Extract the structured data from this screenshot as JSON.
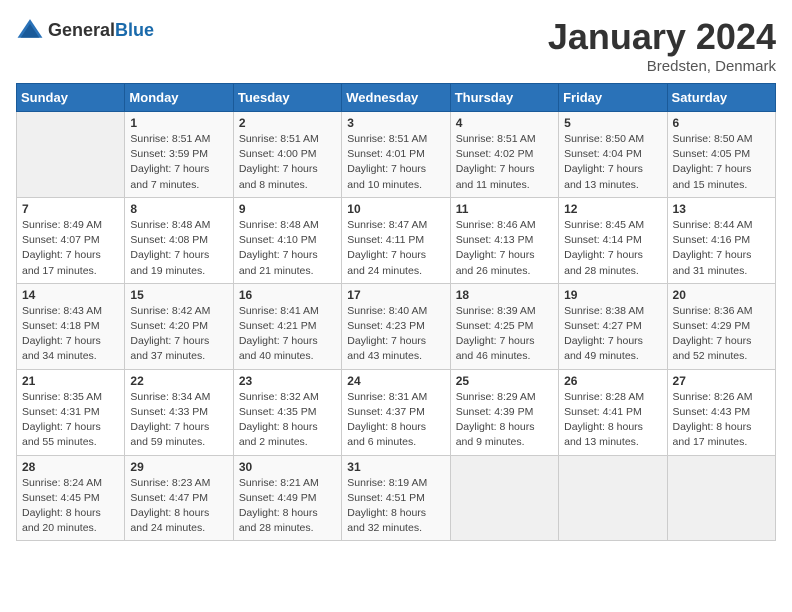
{
  "header": {
    "logo_general": "General",
    "logo_blue": "Blue",
    "month_title": "January 2024",
    "location": "Bredsten, Denmark"
  },
  "days_of_week": [
    "Sunday",
    "Monday",
    "Tuesday",
    "Wednesday",
    "Thursday",
    "Friday",
    "Saturday"
  ],
  "weeks": [
    [
      {
        "day": "",
        "sunrise": "",
        "sunset": "",
        "daylight": ""
      },
      {
        "day": "1",
        "sunrise": "Sunrise: 8:51 AM",
        "sunset": "Sunset: 3:59 PM",
        "daylight": "Daylight: 7 hours and 7 minutes."
      },
      {
        "day": "2",
        "sunrise": "Sunrise: 8:51 AM",
        "sunset": "Sunset: 4:00 PM",
        "daylight": "Daylight: 7 hours and 8 minutes."
      },
      {
        "day": "3",
        "sunrise": "Sunrise: 8:51 AM",
        "sunset": "Sunset: 4:01 PM",
        "daylight": "Daylight: 7 hours and 10 minutes."
      },
      {
        "day": "4",
        "sunrise": "Sunrise: 8:51 AM",
        "sunset": "Sunset: 4:02 PM",
        "daylight": "Daylight: 7 hours and 11 minutes."
      },
      {
        "day": "5",
        "sunrise": "Sunrise: 8:50 AM",
        "sunset": "Sunset: 4:04 PM",
        "daylight": "Daylight: 7 hours and 13 minutes."
      },
      {
        "day": "6",
        "sunrise": "Sunrise: 8:50 AM",
        "sunset": "Sunset: 4:05 PM",
        "daylight": "Daylight: 7 hours and 15 minutes."
      }
    ],
    [
      {
        "day": "7",
        "sunrise": "Sunrise: 8:49 AM",
        "sunset": "Sunset: 4:07 PM",
        "daylight": "Daylight: 7 hours and 17 minutes."
      },
      {
        "day": "8",
        "sunrise": "Sunrise: 8:48 AM",
        "sunset": "Sunset: 4:08 PM",
        "daylight": "Daylight: 7 hours and 19 minutes."
      },
      {
        "day": "9",
        "sunrise": "Sunrise: 8:48 AM",
        "sunset": "Sunset: 4:10 PM",
        "daylight": "Daylight: 7 hours and 21 minutes."
      },
      {
        "day": "10",
        "sunrise": "Sunrise: 8:47 AM",
        "sunset": "Sunset: 4:11 PM",
        "daylight": "Daylight: 7 hours and 24 minutes."
      },
      {
        "day": "11",
        "sunrise": "Sunrise: 8:46 AM",
        "sunset": "Sunset: 4:13 PM",
        "daylight": "Daylight: 7 hours and 26 minutes."
      },
      {
        "day": "12",
        "sunrise": "Sunrise: 8:45 AM",
        "sunset": "Sunset: 4:14 PM",
        "daylight": "Daylight: 7 hours and 28 minutes."
      },
      {
        "day": "13",
        "sunrise": "Sunrise: 8:44 AM",
        "sunset": "Sunset: 4:16 PM",
        "daylight": "Daylight: 7 hours and 31 minutes."
      }
    ],
    [
      {
        "day": "14",
        "sunrise": "Sunrise: 8:43 AM",
        "sunset": "Sunset: 4:18 PM",
        "daylight": "Daylight: 7 hours and 34 minutes."
      },
      {
        "day": "15",
        "sunrise": "Sunrise: 8:42 AM",
        "sunset": "Sunset: 4:20 PM",
        "daylight": "Daylight: 7 hours and 37 minutes."
      },
      {
        "day": "16",
        "sunrise": "Sunrise: 8:41 AM",
        "sunset": "Sunset: 4:21 PM",
        "daylight": "Daylight: 7 hours and 40 minutes."
      },
      {
        "day": "17",
        "sunrise": "Sunrise: 8:40 AM",
        "sunset": "Sunset: 4:23 PM",
        "daylight": "Daylight: 7 hours and 43 minutes."
      },
      {
        "day": "18",
        "sunrise": "Sunrise: 8:39 AM",
        "sunset": "Sunset: 4:25 PM",
        "daylight": "Daylight: 7 hours and 46 minutes."
      },
      {
        "day": "19",
        "sunrise": "Sunrise: 8:38 AM",
        "sunset": "Sunset: 4:27 PM",
        "daylight": "Daylight: 7 hours and 49 minutes."
      },
      {
        "day": "20",
        "sunrise": "Sunrise: 8:36 AM",
        "sunset": "Sunset: 4:29 PM",
        "daylight": "Daylight: 7 hours and 52 minutes."
      }
    ],
    [
      {
        "day": "21",
        "sunrise": "Sunrise: 8:35 AM",
        "sunset": "Sunset: 4:31 PM",
        "daylight": "Daylight: 7 hours and 55 minutes."
      },
      {
        "day": "22",
        "sunrise": "Sunrise: 8:34 AM",
        "sunset": "Sunset: 4:33 PM",
        "daylight": "Daylight: 7 hours and 59 minutes."
      },
      {
        "day": "23",
        "sunrise": "Sunrise: 8:32 AM",
        "sunset": "Sunset: 4:35 PM",
        "daylight": "Daylight: 8 hours and 2 minutes."
      },
      {
        "day": "24",
        "sunrise": "Sunrise: 8:31 AM",
        "sunset": "Sunset: 4:37 PM",
        "daylight": "Daylight: 8 hours and 6 minutes."
      },
      {
        "day": "25",
        "sunrise": "Sunrise: 8:29 AM",
        "sunset": "Sunset: 4:39 PM",
        "daylight": "Daylight: 8 hours and 9 minutes."
      },
      {
        "day": "26",
        "sunrise": "Sunrise: 8:28 AM",
        "sunset": "Sunset: 4:41 PM",
        "daylight": "Daylight: 8 hours and 13 minutes."
      },
      {
        "day": "27",
        "sunrise": "Sunrise: 8:26 AM",
        "sunset": "Sunset: 4:43 PM",
        "daylight": "Daylight: 8 hours and 17 minutes."
      }
    ],
    [
      {
        "day": "28",
        "sunrise": "Sunrise: 8:24 AM",
        "sunset": "Sunset: 4:45 PM",
        "daylight": "Daylight: 8 hours and 20 minutes."
      },
      {
        "day": "29",
        "sunrise": "Sunrise: 8:23 AM",
        "sunset": "Sunset: 4:47 PM",
        "daylight": "Daylight: 8 hours and 24 minutes."
      },
      {
        "day": "30",
        "sunrise": "Sunrise: 8:21 AM",
        "sunset": "Sunset: 4:49 PM",
        "daylight": "Daylight: 8 hours and 28 minutes."
      },
      {
        "day": "31",
        "sunrise": "Sunrise: 8:19 AM",
        "sunset": "Sunset: 4:51 PM",
        "daylight": "Daylight: 8 hours and 32 minutes."
      },
      {
        "day": "",
        "sunrise": "",
        "sunset": "",
        "daylight": ""
      },
      {
        "day": "",
        "sunrise": "",
        "sunset": "",
        "daylight": ""
      },
      {
        "day": "",
        "sunrise": "",
        "sunset": "",
        "daylight": ""
      }
    ]
  ]
}
